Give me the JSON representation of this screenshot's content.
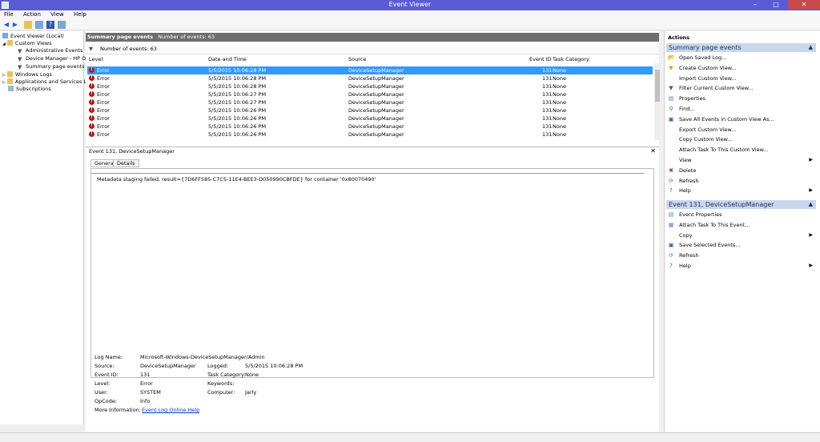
{
  "window": {
    "title": "Event Viewer",
    "minimize": "–",
    "maximize": "□",
    "close": "✕"
  },
  "menu": [
    "File",
    "Action",
    "View",
    "Help"
  ],
  "tree": {
    "root": "Event Viewer (Local)",
    "custom_views": "Custom Views",
    "admin_events": "Administrative Events",
    "device_manager": "Device Manager - HP Offi",
    "summary": "Summary page events",
    "windows_logs": "Windows Logs",
    "apps_services": "Applications and Services Lo",
    "subscriptions": "Subscriptions"
  },
  "middle": {
    "header_title": "Summary page events",
    "header_count": "Number of events: 63",
    "filter_text": "Number of events: 63",
    "columns": {
      "level": "Level",
      "date": "Date and Time",
      "source": "Source",
      "event_id": "Event ID",
      "task": "Task Category"
    },
    "rows": [
      {
        "level": "Error",
        "date": "5/5/2015 10:06:28 PM",
        "source": "DeviceSetupManager",
        "id": "131",
        "task": "None"
      },
      {
        "level": "Error",
        "date": "5/5/2015 10:06:28 PM",
        "source": "DeviceSetupManager",
        "id": "131",
        "task": "None"
      },
      {
        "level": "Error",
        "date": "5/5/2015 10:06:28 PM",
        "source": "DeviceSetupManager",
        "id": "131",
        "task": "None"
      },
      {
        "level": "Error",
        "date": "5/5/2015 10:06:27 PM",
        "source": "DeviceSetupManager",
        "id": "131",
        "task": "None"
      },
      {
        "level": "Error",
        "date": "5/5/2015 10:06:27 PM",
        "source": "DeviceSetupManager",
        "id": "131",
        "task": "None"
      },
      {
        "level": "Error",
        "date": "5/5/2015 10:06:26 PM",
        "source": "DeviceSetupManager",
        "id": "131",
        "task": "None"
      },
      {
        "level": "Error",
        "date": "5/5/2015 10:06:26 PM",
        "source": "DeviceSetupManager",
        "id": "131",
        "task": "None"
      },
      {
        "level": "Error",
        "date": "5/5/2015 10:06:26 PM",
        "source": "DeviceSetupManager",
        "id": "131",
        "task": "None"
      },
      {
        "level": "Error",
        "date": "5/5/2015 10:06:26 PM",
        "source": "DeviceSetupManager",
        "id": "131",
        "task": "None"
      }
    ],
    "detail_title": "Event 131, DeviceSetupManager",
    "tab_general": "General",
    "tab_details": "Details",
    "message": "Metadata staging failed, result={7D6FF585-C7C5-11E4-BEE3-D050990CBFDE} for container '0x80070490'",
    "props": {
      "log_name_l": "Log Name:",
      "log_name_v": "Microsoft-Windows-DeviceSetupManager/Admin",
      "source_l": "Source:",
      "source_v": "DeviceSetupManager",
      "logged_l": "Logged:",
      "logged_v": "5/5/2015 10:06:28 PM",
      "event_id_l": "Event ID:",
      "event_id_v": "131",
      "task_l": "Task Category:",
      "task_v": "None",
      "level_l": "Level:",
      "level_v": "Error",
      "keywords_l": "Keywords:",
      "user_l": "User:",
      "user_v": "SYSTEM",
      "computer_l": "Computer:",
      "computer_v": "Jarly",
      "opcode_l": "OpCode:",
      "opcode_v": "Info",
      "more_l": "More Information:",
      "more_v": "Event Log Online Help"
    }
  },
  "actions": {
    "title": "Actions",
    "section1": "Summary page events",
    "items1": [
      "Open Saved Log...",
      "Create Custom View...",
      "Import Custom View...",
      "Filter Current Custom View...",
      "Properties",
      "Find...",
      "Save All Events in Custom View As...",
      "Export Custom View...",
      "Copy Custom View...",
      "Attach Task To This Custom View...",
      "View",
      "Delete",
      "Refresh",
      "Help"
    ],
    "section2": "Event 131, DeviceSetupManager",
    "items2": [
      "Event Properties",
      "Attach Task To This Event...",
      "Copy",
      "Save Selected Events...",
      "Refresh",
      "Help"
    ]
  }
}
